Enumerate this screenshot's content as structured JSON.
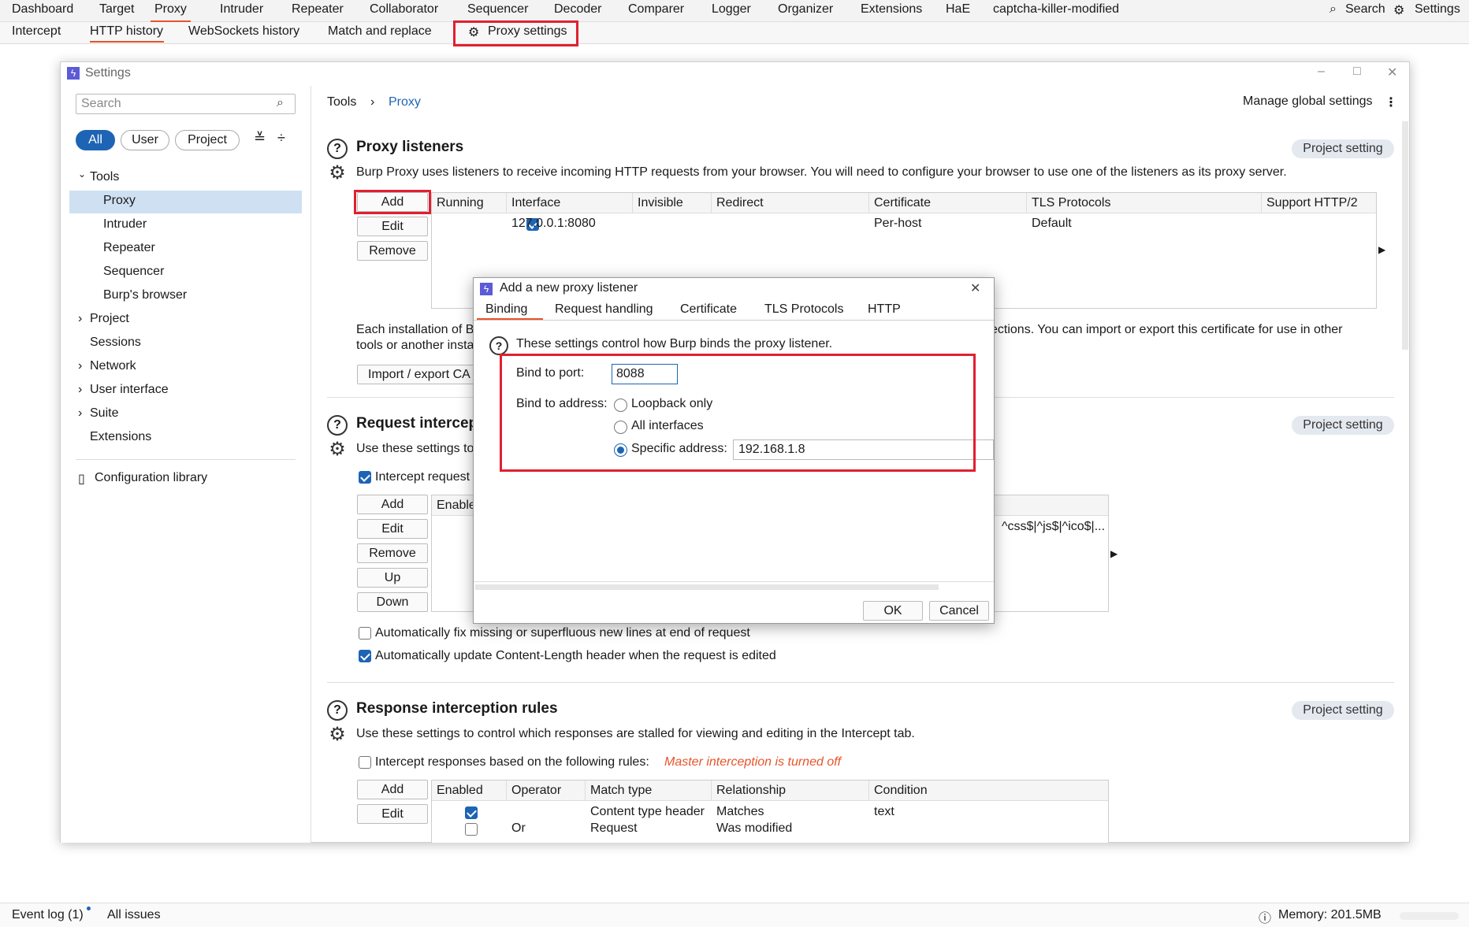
{
  "top_tabs": [
    "Dashboard",
    "Target",
    "Proxy",
    "Intruder",
    "Repeater",
    "Collaborator",
    "Sequencer",
    "Decoder",
    "Comparer",
    "Logger",
    "Organizer",
    "Extensions",
    "HaE",
    "captcha-killer-modified"
  ],
  "top_right": {
    "search_label": "Search",
    "settings_label": "Settings"
  },
  "sub_tabs": [
    "Intercept",
    "HTTP history",
    "WebSockets history",
    "Match and replace",
    "Proxy settings"
  ],
  "window": {
    "title": "Settings"
  },
  "sidebar": {
    "search_placeholder": "Search",
    "filters": [
      "All",
      "User",
      "Project"
    ],
    "tree": [
      "Tools",
      "Proxy",
      "Intruder",
      "Repeater",
      "Sequencer",
      "Burp's browser",
      "Project",
      "Sessions",
      "Network",
      "User interface",
      "Suite",
      "Extensions"
    ],
    "config_library": "Configuration library"
  },
  "breadcrumb": {
    "root": "Tools",
    "current": "Proxy",
    "manage": "Manage global settings"
  },
  "listeners": {
    "title": "Proxy listeners",
    "badge": "Project setting",
    "desc": "Burp Proxy uses listeners to receive incoming HTTP requests from your browser. You will need to configure your browser to use one of the listeners as its proxy server.",
    "buttons": [
      "Add",
      "Edit",
      "Remove"
    ],
    "columns": [
      "Running",
      "Interface",
      "Invisible",
      "Redirect",
      "Certificate",
      "TLS Protocols",
      "Support HTTP/2"
    ],
    "row": {
      "interface": "127.0.0.1:8080",
      "certificate": "Per-host",
      "tls": "Default"
    },
    "ca_text_1": "Each installation of B",
    "ca_text_1b": "ections. You can import or export this certificate for use in other",
    "ca_text_2": "tools or another insta",
    "import_button": "Import / export CA"
  },
  "request_rules": {
    "title": "Request intercep",
    "badge": "Project setting",
    "desc": "Use these settings to",
    "intercept_label": "Intercept request",
    "buttons": [
      "Add",
      "Edit",
      "Remove",
      "Up",
      "Down"
    ],
    "col_enabled": "Enable",
    "condition_snippet": "^css$|^js$|^ico$|...",
    "fix_newlines": "Automatically fix missing or superfluous new lines at end of request",
    "update_length": "Automatically update Content-Length header when the request is edited"
  },
  "response_rules": {
    "title": "Response interception rules",
    "badge": "Project setting",
    "desc": "Use these settings to control which responses are stalled for viewing and editing in the Intercept tab.",
    "intercept_label": "Intercept responses based on the following rules:",
    "warning": "Master interception is turned off",
    "buttons": [
      "Add",
      "Edit"
    ],
    "columns": [
      "Enabled",
      "Operator",
      "Match type",
      "Relationship",
      "Condition"
    ],
    "rows": [
      {
        "operator": "",
        "match": "Content type header",
        "rel": "Matches",
        "cond": "text"
      },
      {
        "operator": "Or",
        "match": "Request",
        "rel": "Was modified",
        "cond": ""
      }
    ]
  },
  "dialog": {
    "title": "Add a new proxy listener",
    "tabs": [
      "Binding",
      "Request handling",
      "Certificate",
      "TLS Protocols",
      "HTTP"
    ],
    "info": "These settings control how Burp binds the proxy listener.",
    "port_label": "Bind to port:",
    "port_value": "8088",
    "address_label": "Bind to address:",
    "options": [
      "Loopback only",
      "All interfaces",
      "Specific address:"
    ],
    "specific_value": "192.168.1.8",
    "ok": "OK",
    "cancel": "Cancel"
  },
  "status": {
    "event_log": "Event log (1)",
    "all_issues": "All issues",
    "memory": "Memory: 201.5MB"
  },
  "colors": {
    "accent": "#e8542b",
    "highlight": "#e02030",
    "primary": "#1e64b4",
    "selected": "#cfe0f3"
  }
}
